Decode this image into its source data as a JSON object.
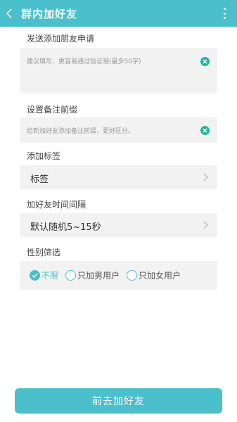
{
  "header": {
    "title": "群内加好友"
  },
  "request_section": {
    "label": "发送添加朋友申请",
    "placeholder": "建议填写、更容易通过验证哦(最多50字)"
  },
  "remark_section": {
    "label": "设置备注前缀",
    "placeholder": "给新加好友添加备注前缀，更好区分。"
  },
  "tag_section": {
    "label": "添加标签",
    "value": "标签"
  },
  "interval_section": {
    "label": "加好友时间间隔",
    "value": "默认随机5~15秒"
  },
  "gender_section": {
    "label": "性别筛选",
    "options": [
      {
        "label": "不限",
        "selected": true
      },
      {
        "label": "只加男用户",
        "selected": false
      },
      {
        "label": "只加女用户",
        "selected": false
      }
    ]
  },
  "submit": {
    "label": "前去加好友"
  },
  "colors": {
    "accent": "#4cbfcc",
    "clear_icon": "#27b49a",
    "field_bg": "#f2f2f2"
  }
}
